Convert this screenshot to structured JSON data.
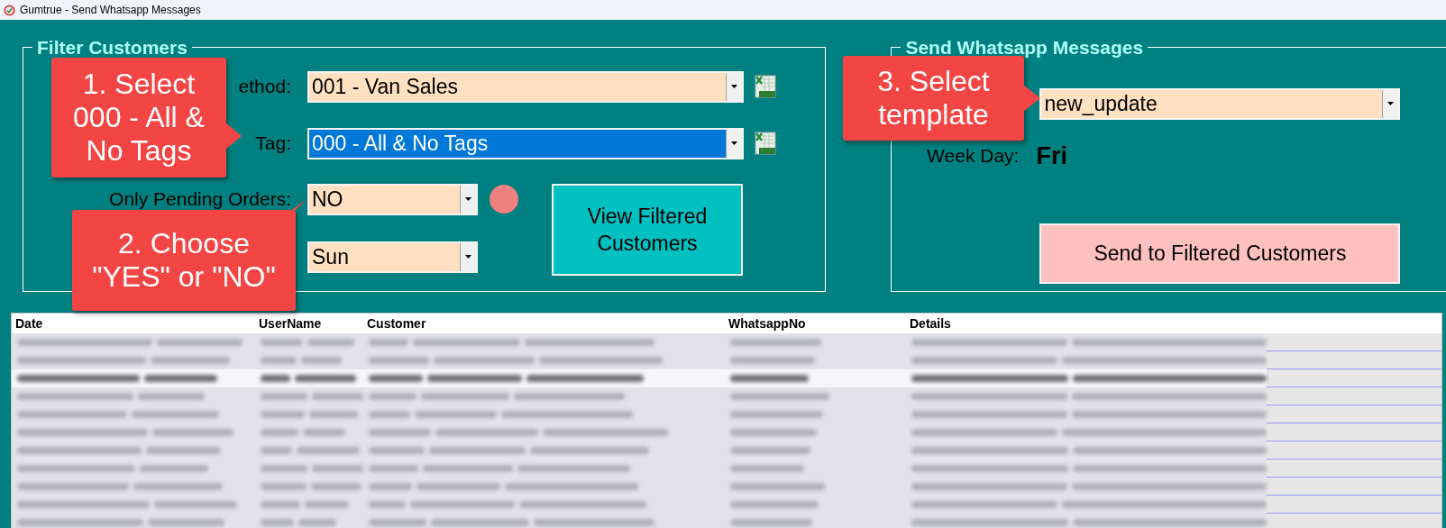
{
  "window": {
    "title": "Gumtrue - Send Whatsapp Messages"
  },
  "filter_customers": {
    "title": "Filter Customers",
    "fields": [
      {
        "label": "ethod:",
        "value": "001 - Van Sales",
        "selected": false
      },
      {
        "label": "Tag:",
        "value": "000 - All & No Tags",
        "selected": true
      }
    ],
    "pending": {
      "label": "Only Pending Orders:",
      "value": "NO"
    },
    "day": {
      "value": "Sun"
    },
    "button": "View Filtered Customers"
  },
  "send_messages": {
    "title": "Send Whatsapp Messages",
    "template": "new_update",
    "week_day_label": "Week Day:",
    "week_day": "Fri",
    "button": "Send to Filtered Customers"
  },
  "table": {
    "columns": [
      "Date",
      "UserName",
      "Customer",
      "WhatsappNo",
      "Details"
    ],
    "rows": [
      {
        "selected": false
      },
      {
        "selected": false
      },
      {
        "selected": true
      },
      {
        "selected": false
      },
      {
        "selected": false
      },
      {
        "selected": false
      },
      {
        "selected": false
      },
      {
        "selected": false
      },
      {
        "selected": false
      },
      {
        "selected": false
      },
      {
        "selected": false
      }
    ]
  },
  "callouts": [
    {
      "text": "1. Select\n000 - All &\nNo Tags"
    },
    {
      "text": "2. Choose\n\"YES\" or \"NO\""
    },
    {
      "text": "3. Select\ntemplate"
    }
  ]
}
